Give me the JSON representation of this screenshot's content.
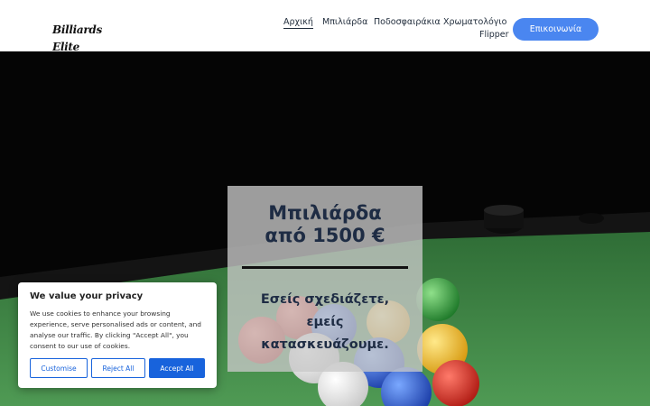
{
  "header": {
    "logo_text": "Billiards Elite",
    "nav": [
      "Αρχική",
      "Μπιλιάρδα",
      "Ποδοσφαιράκια",
      "Χρωματολόγιο",
      "Flipper"
    ],
    "contact_label": "Επικοινωνία"
  },
  "hero": {
    "title_line1": "Μπιλιάρδα",
    "title_line2": "από 1500 €",
    "sub_line1": "Εσείς σχεδιάζετε,",
    "sub_line2": "εμείς",
    "sub_line3": "κατασκευάζουμε."
  },
  "cookie": {
    "title": "We value your privacy",
    "text": "We use cookies to enhance your browsing experience, serve personalised ads or content, and analyse our traffic. By clicking \"Accept All\", you consent to our use of cookies.",
    "customise_label": "Customise",
    "reject_label": "Reject All",
    "accept_label": "Accept All"
  },
  "colors": {
    "accent": "#4a86f0",
    "cookie_primary": "#1863dc",
    "table_felt": "#3f8a46",
    "hero_text": "#1e2c44"
  }
}
